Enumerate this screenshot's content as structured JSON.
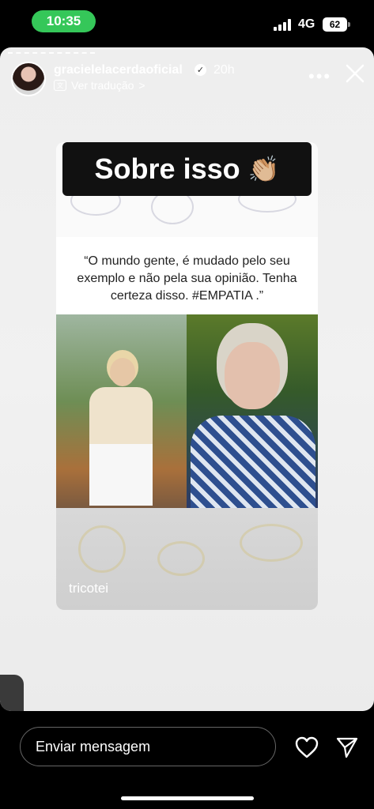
{
  "status_bar": {
    "time": "10:35",
    "network": "4G",
    "battery": "62"
  },
  "story": {
    "username": "gracielelacerdaoficial",
    "time_ago": "20h",
    "translate_label": "Ver tradução",
    "translate_chevron": ">",
    "sticker_title": "Sobre isso",
    "sticker_emoji": "👏🏼",
    "quote": "“O mundo gente, é mudado pelo seu exemplo e não pela sua opinião. Tenha certeza disso. #EMPATIA .”",
    "post_caption": "tricotei",
    "side_tab_chevron": "›"
  },
  "bottom_bar": {
    "message_placeholder": "Enviar mensagem"
  },
  "icons": {
    "more": "more-icon",
    "close": "close-icon",
    "heart": "heart-icon",
    "send": "send-icon",
    "verified": "verified-icon"
  },
  "colors": {
    "time_pill": "#35c759",
    "background": "#000000",
    "sticker": "#111111"
  }
}
